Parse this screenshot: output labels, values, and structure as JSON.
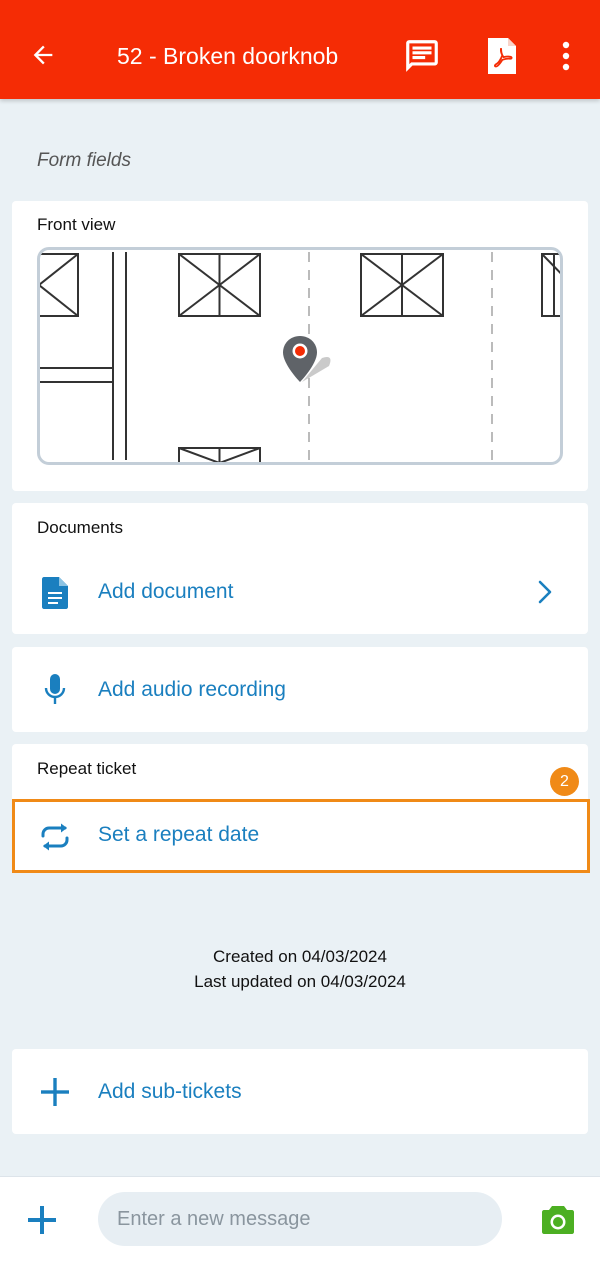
{
  "header": {
    "title": "52 - Broken doorknob",
    "back_icon": "arrow-back-icon",
    "icons": [
      "chat-icon",
      "pdf-icon",
      "more-vert-icon"
    ]
  },
  "form": {
    "section_label": "Form fields",
    "front_view": {
      "title": "Front view"
    }
  },
  "documents": {
    "title": "Documents",
    "add_document_label": "Add document"
  },
  "audio": {
    "add_audio_label": "Add audio recording"
  },
  "repeat": {
    "title": "Repeat ticket",
    "set_repeat_label": "Set a repeat date",
    "badge": "2"
  },
  "meta": {
    "created": "Created on 04/03/2024",
    "updated": "Last updated on 04/03/2024"
  },
  "subtickets": {
    "add_label": "Add sub-tickets"
  },
  "composer": {
    "placeholder": "Enter a new message"
  },
  "colors": {
    "appbar": "#f52c05",
    "accent": "#1a7fbf",
    "highlight": "#f08a17",
    "camera": "#4caf22"
  }
}
